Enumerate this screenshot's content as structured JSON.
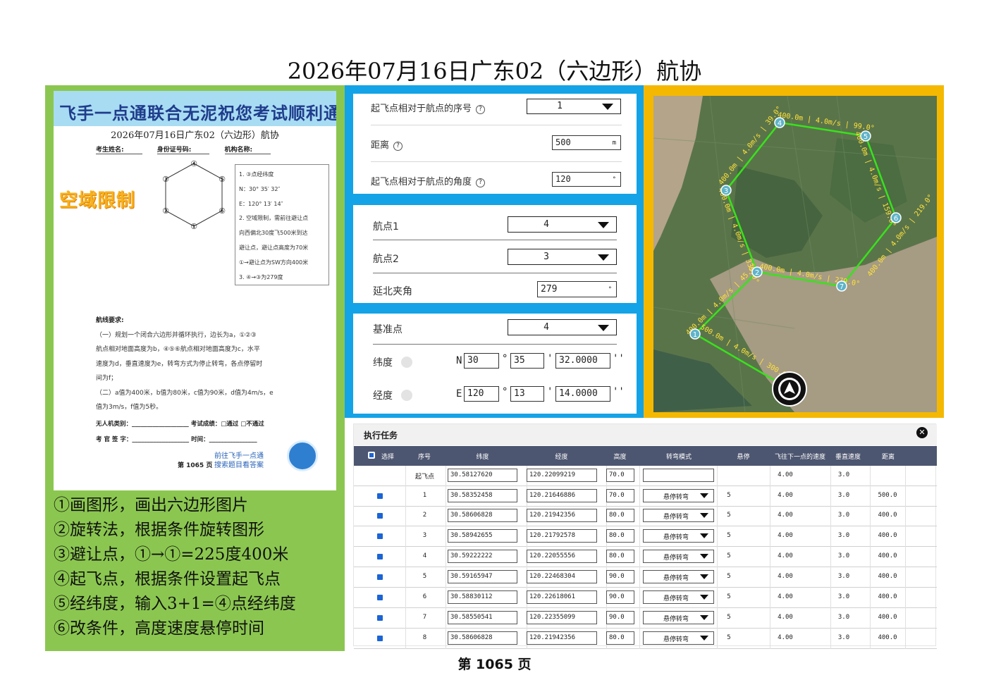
{
  "title": "2026年07月16日广东02（六边形）航协",
  "paper": {
    "banner": "飞手一点通联合无泥祝您考试顺利通过",
    "title": "2026年07月16日广东02（六边形）航协",
    "fields": [
      "考生姓名:",
      "身份证号码:",
      "机构名称:"
    ],
    "stamp": "空域限制",
    "hex_labels": [
      "①",
      "②",
      "③",
      "④",
      "⑤",
      "⑥"
    ],
    "rules": [
      "1. ③点经纬度",
      "   N：30° 35′ 32″",
      "   E：120° 13′ 14″",
      "2. 空域限制，需前往避让点",
      "   向西偏北30度飞500米到达",
      "避让点，避让点高度为70米",
      "   ①→避让点为SW方向400米",
      "3. ④→③为279度"
    ],
    "route_title": "航线要求:",
    "route_lines": [
      "（一）规划一个闭合六边形并循环执行，边长为a，①②③",
      "航点相对地面高度为b，④⑤⑥航点相对地面高度为c，水平",
      "速度为d，垂直速度为e，转弯方式为停止转弯，各点停留时",
      "间为f；",
      "（二）a值为400米，b值为80米，c值为90米，d值为4m/s，e",
      "值为3m/s，f值为5秒。"
    ],
    "sign_lines": [
      "无人机类别：___________________  考试成绩：□通过  □不通过",
      "考 官 签 字：___________________  时间：________________"
    ],
    "page": "第 1065 页",
    "link": [
      "前往飞手一点通",
      "搜索题目看答案"
    ]
  },
  "steps": [
    "①画图形，画出六边形图片",
    "②旋转法，根据条件旋转图形",
    "③避让点，①→①=225度400米",
    "④起飞点，根据条件设置起飞点",
    "⑤经纬度，输入3+1=④点经纬度",
    "⑥改条件，高度速度悬停时间"
  ],
  "takeoff": {
    "seq_label": "起飞点相对于航点的序号",
    "seq_value": "1",
    "distance_label": "距离",
    "distance_value": "500",
    "distance_unit": "m",
    "angle_label": "起飞点相对于航点的角度",
    "angle_value": "120",
    "angle_unit": "°"
  },
  "rotation": {
    "wp1_label": "航点1",
    "wp1_value": "4",
    "wp2_label": "航点2",
    "wp2_value": "3",
    "angle_label": "延北夹角",
    "angle_value": "279",
    "angle_unit": "°"
  },
  "reference": {
    "base_label": "基准点",
    "base_value": "4",
    "lat_label": "纬度",
    "lat_hemi": "N",
    "lat_deg": "30",
    "lat_min": "35",
    "lat_sec": "32.0000",
    "lon_label": "经度",
    "lon_hemi": "E",
    "lon_deg": "120",
    "lon_min": "13",
    "lon_sec": "14.0000",
    "deg_sym": "°",
    "min_sym": "'",
    "sec_sym": "''"
  },
  "map": {
    "waypoints": [
      "1",
      "2",
      "3",
      "4",
      "5",
      "6",
      "7"
    ],
    "seg_labels": [
      "400.0m | 4.0m/s | 99.0°",
      "400.0m | 4.0m/s | 159.0°",
      "400.0m | 4.0m/s | 219.0°",
      "400.0m | 4.0m/s | 279.0°",
      "400.0m | 4.0m/s | 339.0°",
      "400.0m | 4.0m/s | 39.0°",
      "400.0m | 4.0m/s | 45.0°",
      "500.0m | 4.0m/s | 300.0°"
    ],
    "colors": {
      "route": "#39e21c",
      "label": "#ffe23a",
      "marker": "#5fb3c9"
    }
  },
  "task": {
    "title": "执行任务",
    "columns": [
      "选择",
      "序号",
      "纬度",
      "经度",
      "高度",
      "转弯模式",
      "悬停",
      "飞往下一点的速度",
      "垂直速度",
      "距离"
    ],
    "rows": [
      {
        "seq": "起飞点",
        "lat": "30.58127620",
        "lon": "120.22099219",
        "alt": "70.0",
        "mode": "",
        "hover": "",
        "speed": "4.00",
        "vspeed": "3.0",
        "dist": ""
      },
      {
        "seq": "1",
        "lat": "30.58352458",
        "lon": "120.21646886",
        "alt": "70.0",
        "mode": "悬停转弯",
        "hover": "5",
        "speed": "4.00",
        "vspeed": "3.0",
        "dist": "500.0"
      },
      {
        "seq": "2",
        "lat": "30.58606828",
        "lon": "120.21942356",
        "alt": "80.0",
        "mode": "悬停转弯",
        "hover": "5",
        "speed": "4.00",
        "vspeed": "3.0",
        "dist": "400.0"
      },
      {
        "seq": "3",
        "lat": "30.58942655",
        "lon": "120.21792578",
        "alt": "80.0",
        "mode": "悬停转弯",
        "hover": "5",
        "speed": "4.00",
        "vspeed": "3.0",
        "dist": "400.0"
      },
      {
        "seq": "4",
        "lat": "30.59222222",
        "lon": "120.22055556",
        "alt": "80.0",
        "mode": "悬停转弯",
        "hover": "5",
        "speed": "4.00",
        "vspeed": "3.0",
        "dist": "400.0"
      },
      {
        "seq": "5",
        "lat": "30.59165947",
        "lon": "120.22468304",
        "alt": "90.0",
        "mode": "悬停转弯",
        "hover": "5",
        "speed": "4.00",
        "vspeed": "3.0",
        "dist": "400.0"
      },
      {
        "seq": "6",
        "lat": "30.58830112",
        "lon": "120.22618061",
        "alt": "90.0",
        "mode": "悬停转弯",
        "hover": "5",
        "speed": "4.00",
        "vspeed": "3.0",
        "dist": "400.0"
      },
      {
        "seq": "7",
        "lat": "30.58550541",
        "lon": "120.22355099",
        "alt": "90.0",
        "mode": "悬停转弯",
        "hover": "5",
        "speed": "4.00",
        "vspeed": "3.0",
        "dist": "400.0"
      },
      {
        "seq": "8",
        "lat": "30.58606828",
        "lon": "120.21942356",
        "alt": "80.0",
        "mode": "悬停转弯",
        "hover": "5",
        "speed": "4.00",
        "vspeed": "3.0",
        "dist": "400.0"
      }
    ]
  },
  "footer": "第 1065 页"
}
